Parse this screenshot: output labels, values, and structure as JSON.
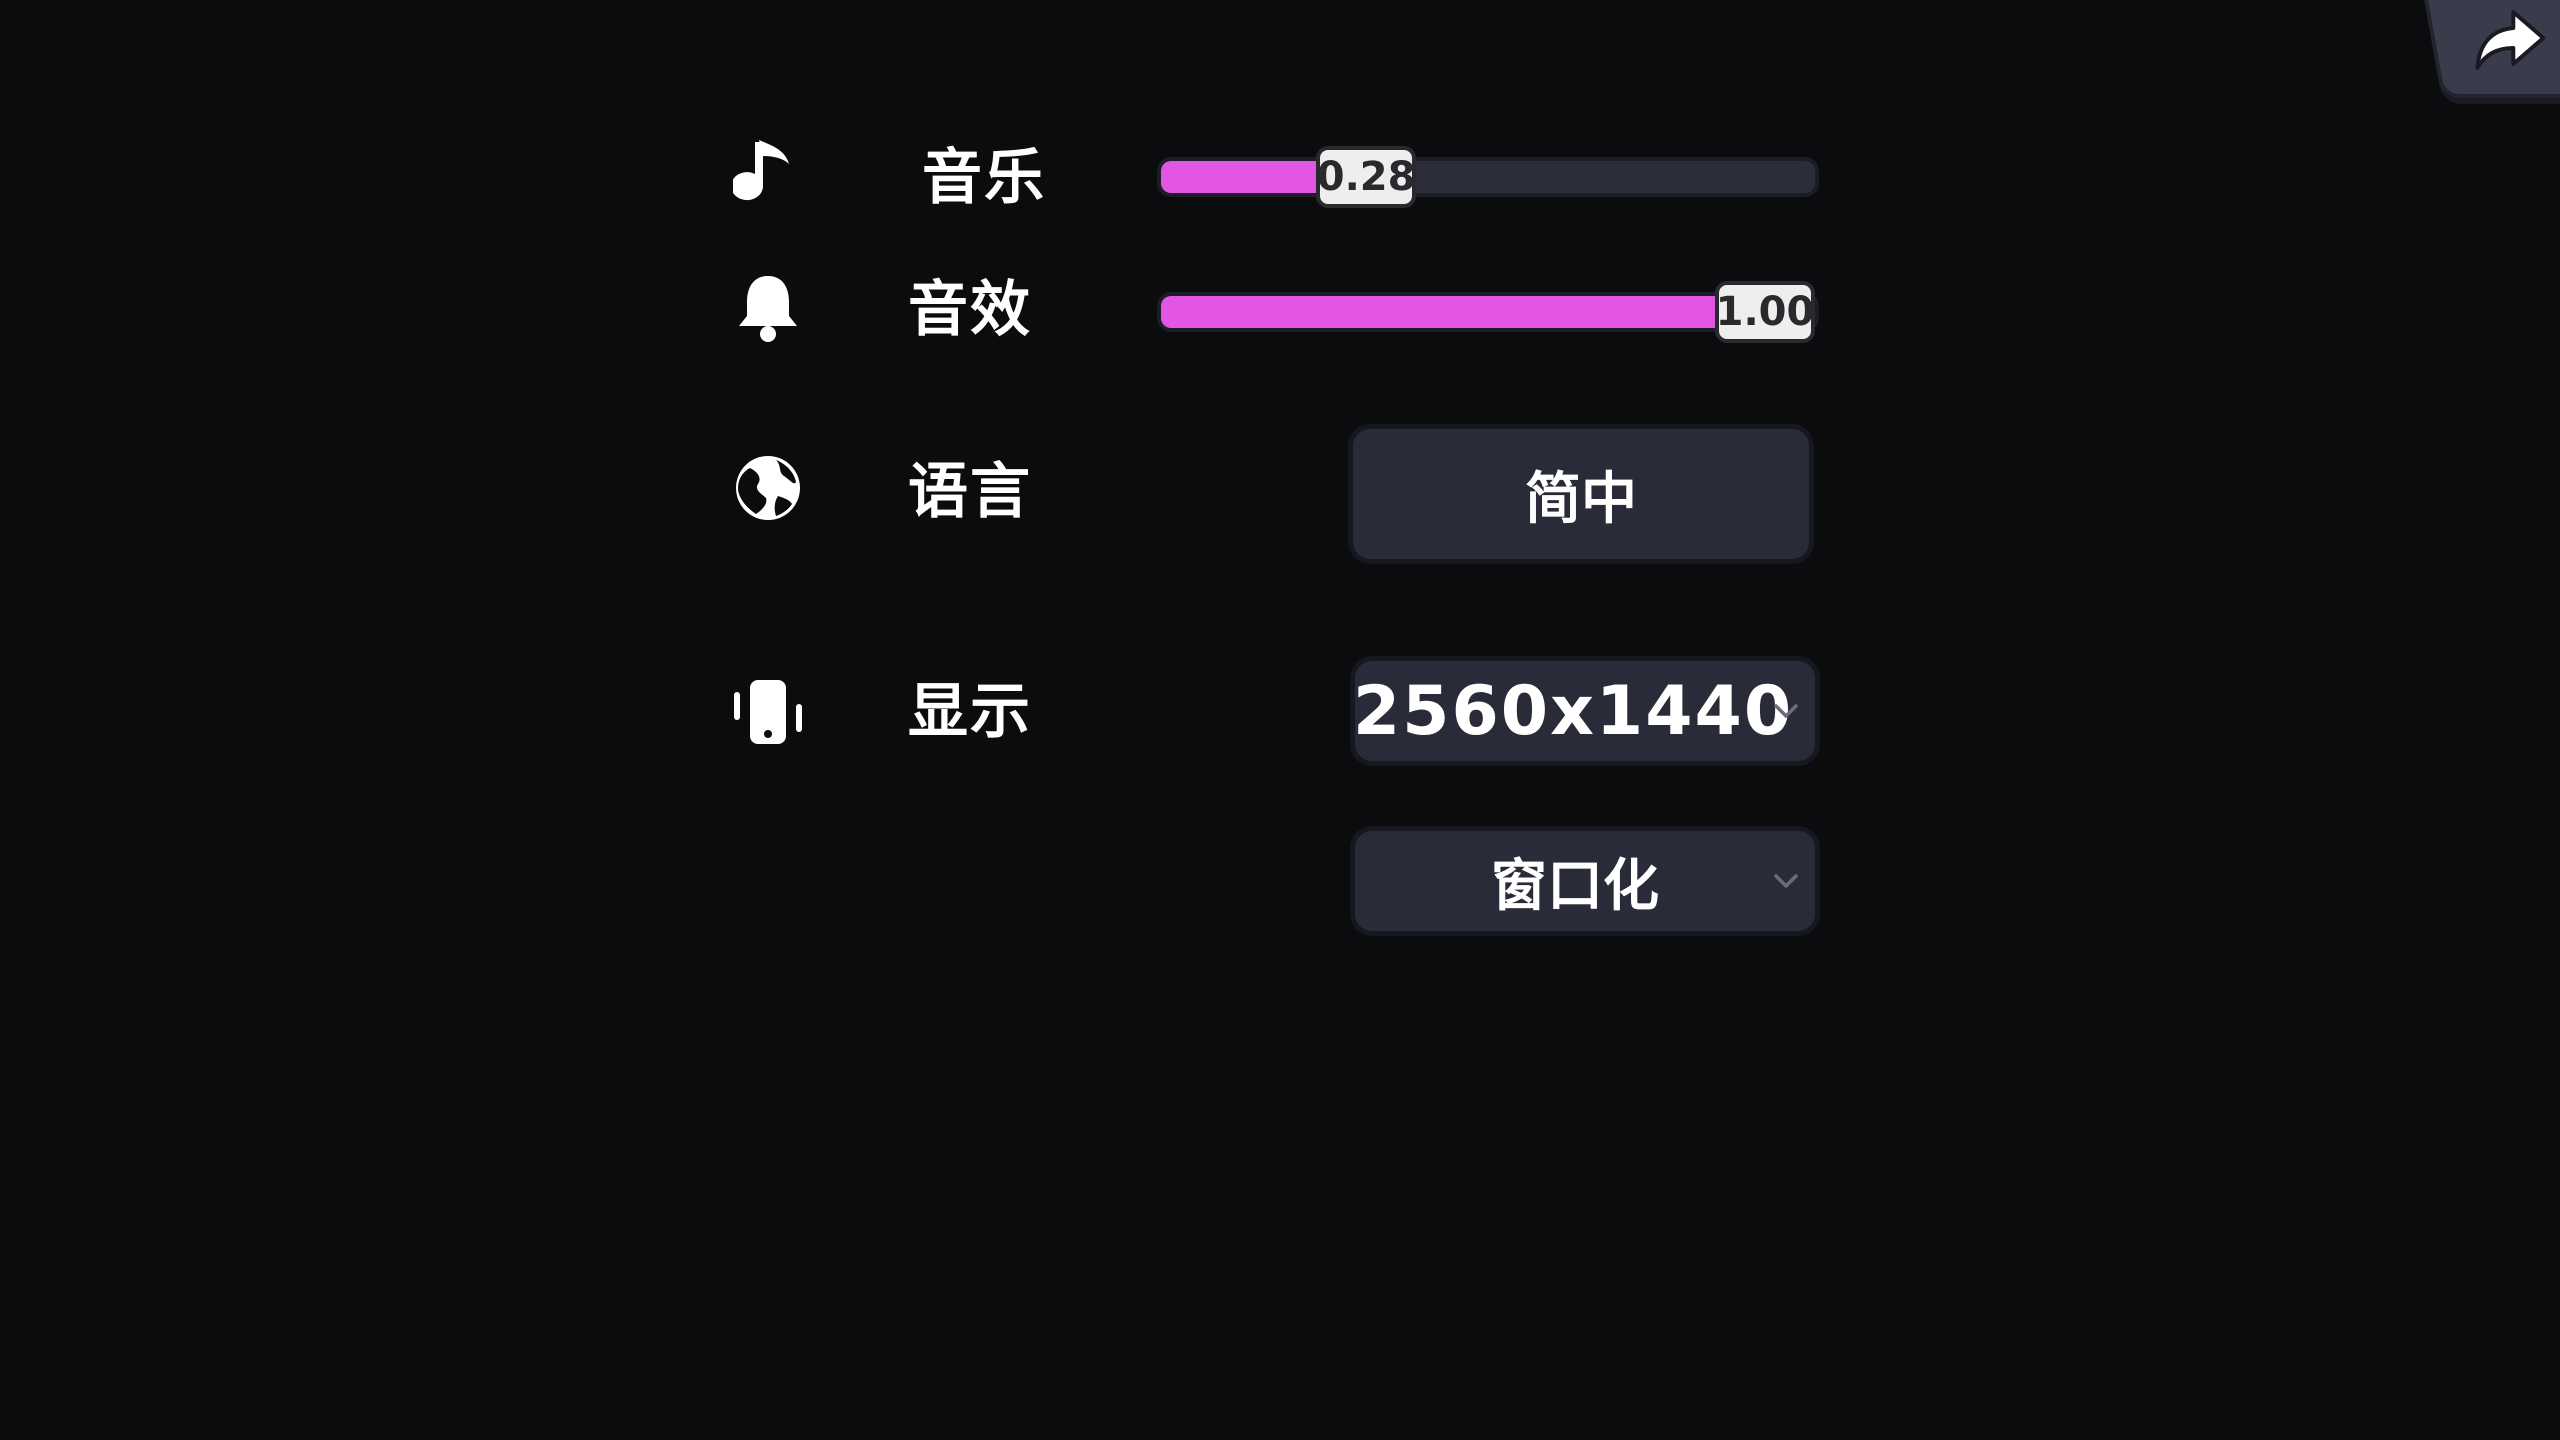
{
  "settings": {
    "music": {
      "label": "音乐",
      "value_text": "0.28",
      "value": 0.28,
      "icon": "music-note-icon"
    },
    "sfx": {
      "label": "音效",
      "value_text": "1.00",
      "value": 1.0,
      "icon": "bell-icon"
    },
    "language": {
      "label": "语言",
      "value": "简中",
      "icon": "globe-icon"
    },
    "display": {
      "label": "显示",
      "resolution": "2560x1440",
      "mode": "窗口化",
      "icon": "phone-vibrate-icon"
    }
  },
  "nav": {
    "back_icon": "forward-arrow-icon"
  },
  "colors": {
    "background": "#0b0c0e",
    "accent": "#e356e4",
    "panel": "#2a2b38",
    "text": "#ffffff"
  }
}
